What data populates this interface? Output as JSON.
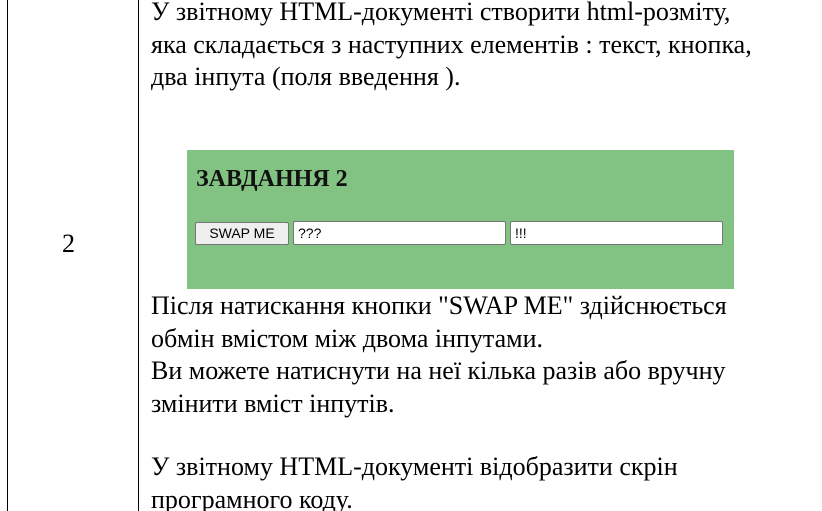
{
  "row": {
    "number": "2"
  },
  "intro": {
    "lines": [
      "У звітному HTML-документі створити html-розміту,",
      "яка складається з наступних елементів : текст, кнопка,",
      "два інпута (поля введення )."
    ]
  },
  "demo": {
    "background_color": "#82c282",
    "title": "ЗАВДАННЯ 2",
    "button_label": "SWAP ME",
    "input1_value": "???",
    "input2_value": "!!!"
  },
  "after": {
    "lines": [
      "Після натискання кнопки \"SWAP ME\" здійснюється",
      "обмін вмістом між двома інпутами.",
      "Ви можете натиснути на неї кілька разів або вручну",
      "змінити вміст інпутів."
    ]
  },
  "report": {
    "lines": [
      "У звітному HTML-документі  відобразити скрін",
      "програмного коду."
    ]
  }
}
